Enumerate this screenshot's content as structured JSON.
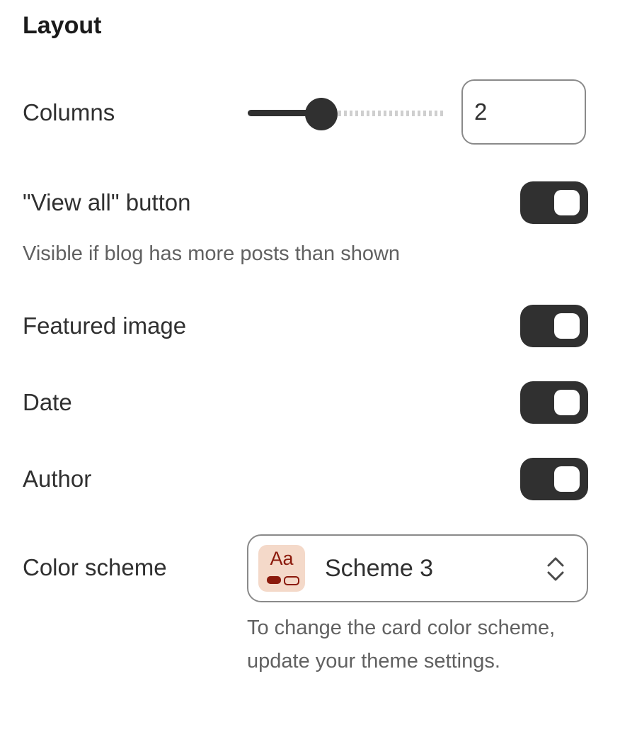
{
  "section": {
    "title": "Layout"
  },
  "columns": {
    "label": "Columns",
    "value": "2",
    "slider_fraction": 0.37
  },
  "view_all": {
    "label": "\"View all\" button",
    "helper": "Visible if blog has more posts than shown",
    "enabled": true
  },
  "featured_image": {
    "label": "Featured image",
    "enabled": true
  },
  "date": {
    "label": "Date",
    "enabled": true
  },
  "author": {
    "label": "Author",
    "enabled": true
  },
  "color_scheme": {
    "label": "Color scheme",
    "swatch_text": "Aa",
    "value": "Scheme 3",
    "helper": "To change the card color scheme, update your theme settings."
  },
  "colors": {
    "toggle_on": "#303030",
    "swatch_bg": "#f4d9c9",
    "swatch_accent": "#8b1a0c"
  },
  "icons": {
    "select_chevron": "chevron-up-down-icon"
  }
}
